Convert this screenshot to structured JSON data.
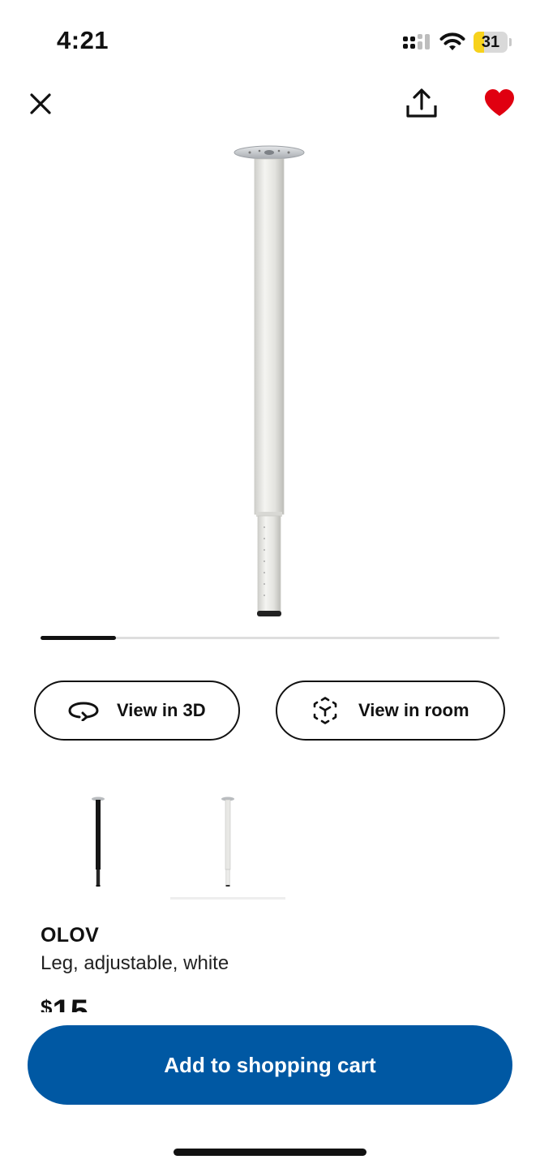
{
  "status_bar": {
    "time": "4:21",
    "battery_level": "31",
    "battery_fraction": 0.31,
    "battery_color": "#f7d21c"
  },
  "top_bar": {
    "icons": [
      "close-icon",
      "share-icon",
      "heart-icon"
    ],
    "favorite_color": "#e00010"
  },
  "gallery": {
    "progress_fraction": 0.165
  },
  "view_buttons": {
    "view_3d_label": "View in 3D",
    "view_3d_icon": "rotate-icon",
    "view_room_label": "View in room",
    "view_room_icon": "ar-cube-icon"
  },
  "variants": [
    {
      "color": "black",
      "selected": false
    },
    {
      "color": "white",
      "selected": true
    }
  ],
  "product": {
    "name": "OLOV",
    "description": "Leg, adjustable, white",
    "price_currency": "$",
    "price_value": "15"
  },
  "cta": {
    "label": "Add to shopping cart",
    "color": "#0058a3"
  }
}
